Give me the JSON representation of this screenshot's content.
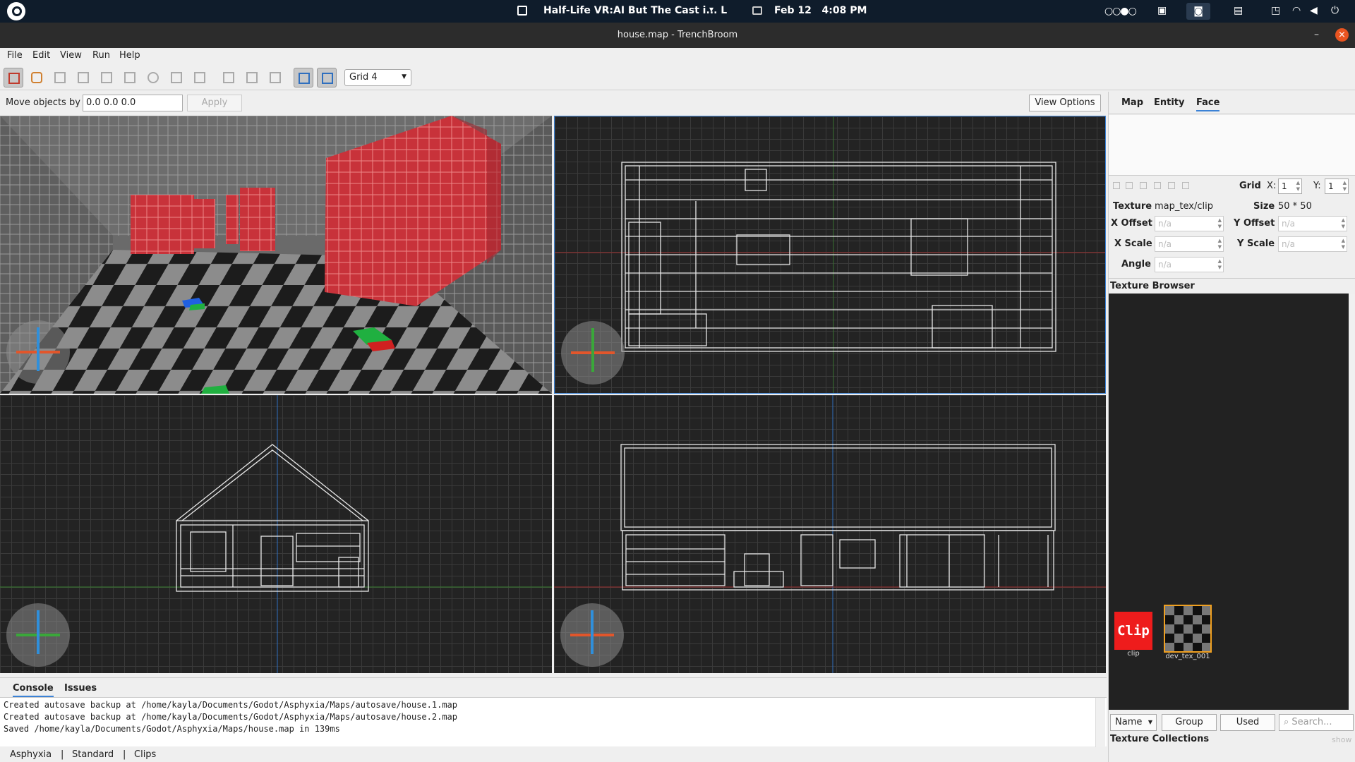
{
  "system_bar": {
    "active_task": "Half-Life VR:AI But The Cast i... L",
    "date": "Feb 12",
    "time": "4:08 PM",
    "indicator": "○○●○"
  },
  "window": {
    "title": "house.map - TrenchBroom",
    "minimize": "–",
    "close": "×"
  },
  "menu": [
    "File",
    "Edit",
    "View",
    "Run",
    "Help"
  ],
  "toolbar": {
    "grid_select": "Grid 4"
  },
  "move_bar": {
    "label": "Move objects by",
    "value": "0.0 0.0 0.0",
    "apply": "Apply",
    "view_options": "View Options"
  },
  "inspector": {
    "tabs": [
      "Map",
      "Entity",
      "Face"
    ],
    "selected_tab": "Face",
    "grid_label": "Grid",
    "grid_x_label": "X:",
    "grid_x": "1",
    "grid_y_label": "Y:",
    "grid_y": "1",
    "texture_label": "Texture",
    "texture_value": "map_tex/clip",
    "size_label": "Size",
    "size_value": "50 * 50",
    "x_offset_label": "X Offset",
    "y_offset_label": "Y Offset",
    "x_scale_label": "X Scale",
    "y_scale_label": "Y Scale",
    "angle_label": "Angle",
    "na": "n/a"
  },
  "texture_browser": {
    "title": "Texture Browser",
    "textures": [
      {
        "name": "clip",
        "swatch_text": "Clip"
      },
      {
        "name": "dev_tex_001",
        "swatch_text": ""
      }
    ],
    "sort": "Name",
    "group": "Group",
    "used": "Used",
    "search_placeholder": "Search...",
    "collections": "Texture Collections",
    "show": "show"
  },
  "console": {
    "tabs": [
      "Console",
      "Issues"
    ],
    "lines": [
      "Created autosave backup at /home/kayla/Documents/Godot/Asphyxia/Maps/autosave/house.1.map",
      "Created autosave backup at /home/kayla/Documents/Godot/Asphyxia/Maps/autosave/house.2.map",
      "Saved /home/kayla/Documents/Godot/Asphyxia/Maps/house.map in 139ms"
    ]
  },
  "status_bar": {
    "items": [
      "Asphyxia",
      "|",
      "Standard",
      "|",
      "Clips"
    ]
  },
  "colors": {
    "clip_red": "#ee1c1c",
    "accent_blue": "#3b82d6",
    "close_orange": "#e95420"
  }
}
